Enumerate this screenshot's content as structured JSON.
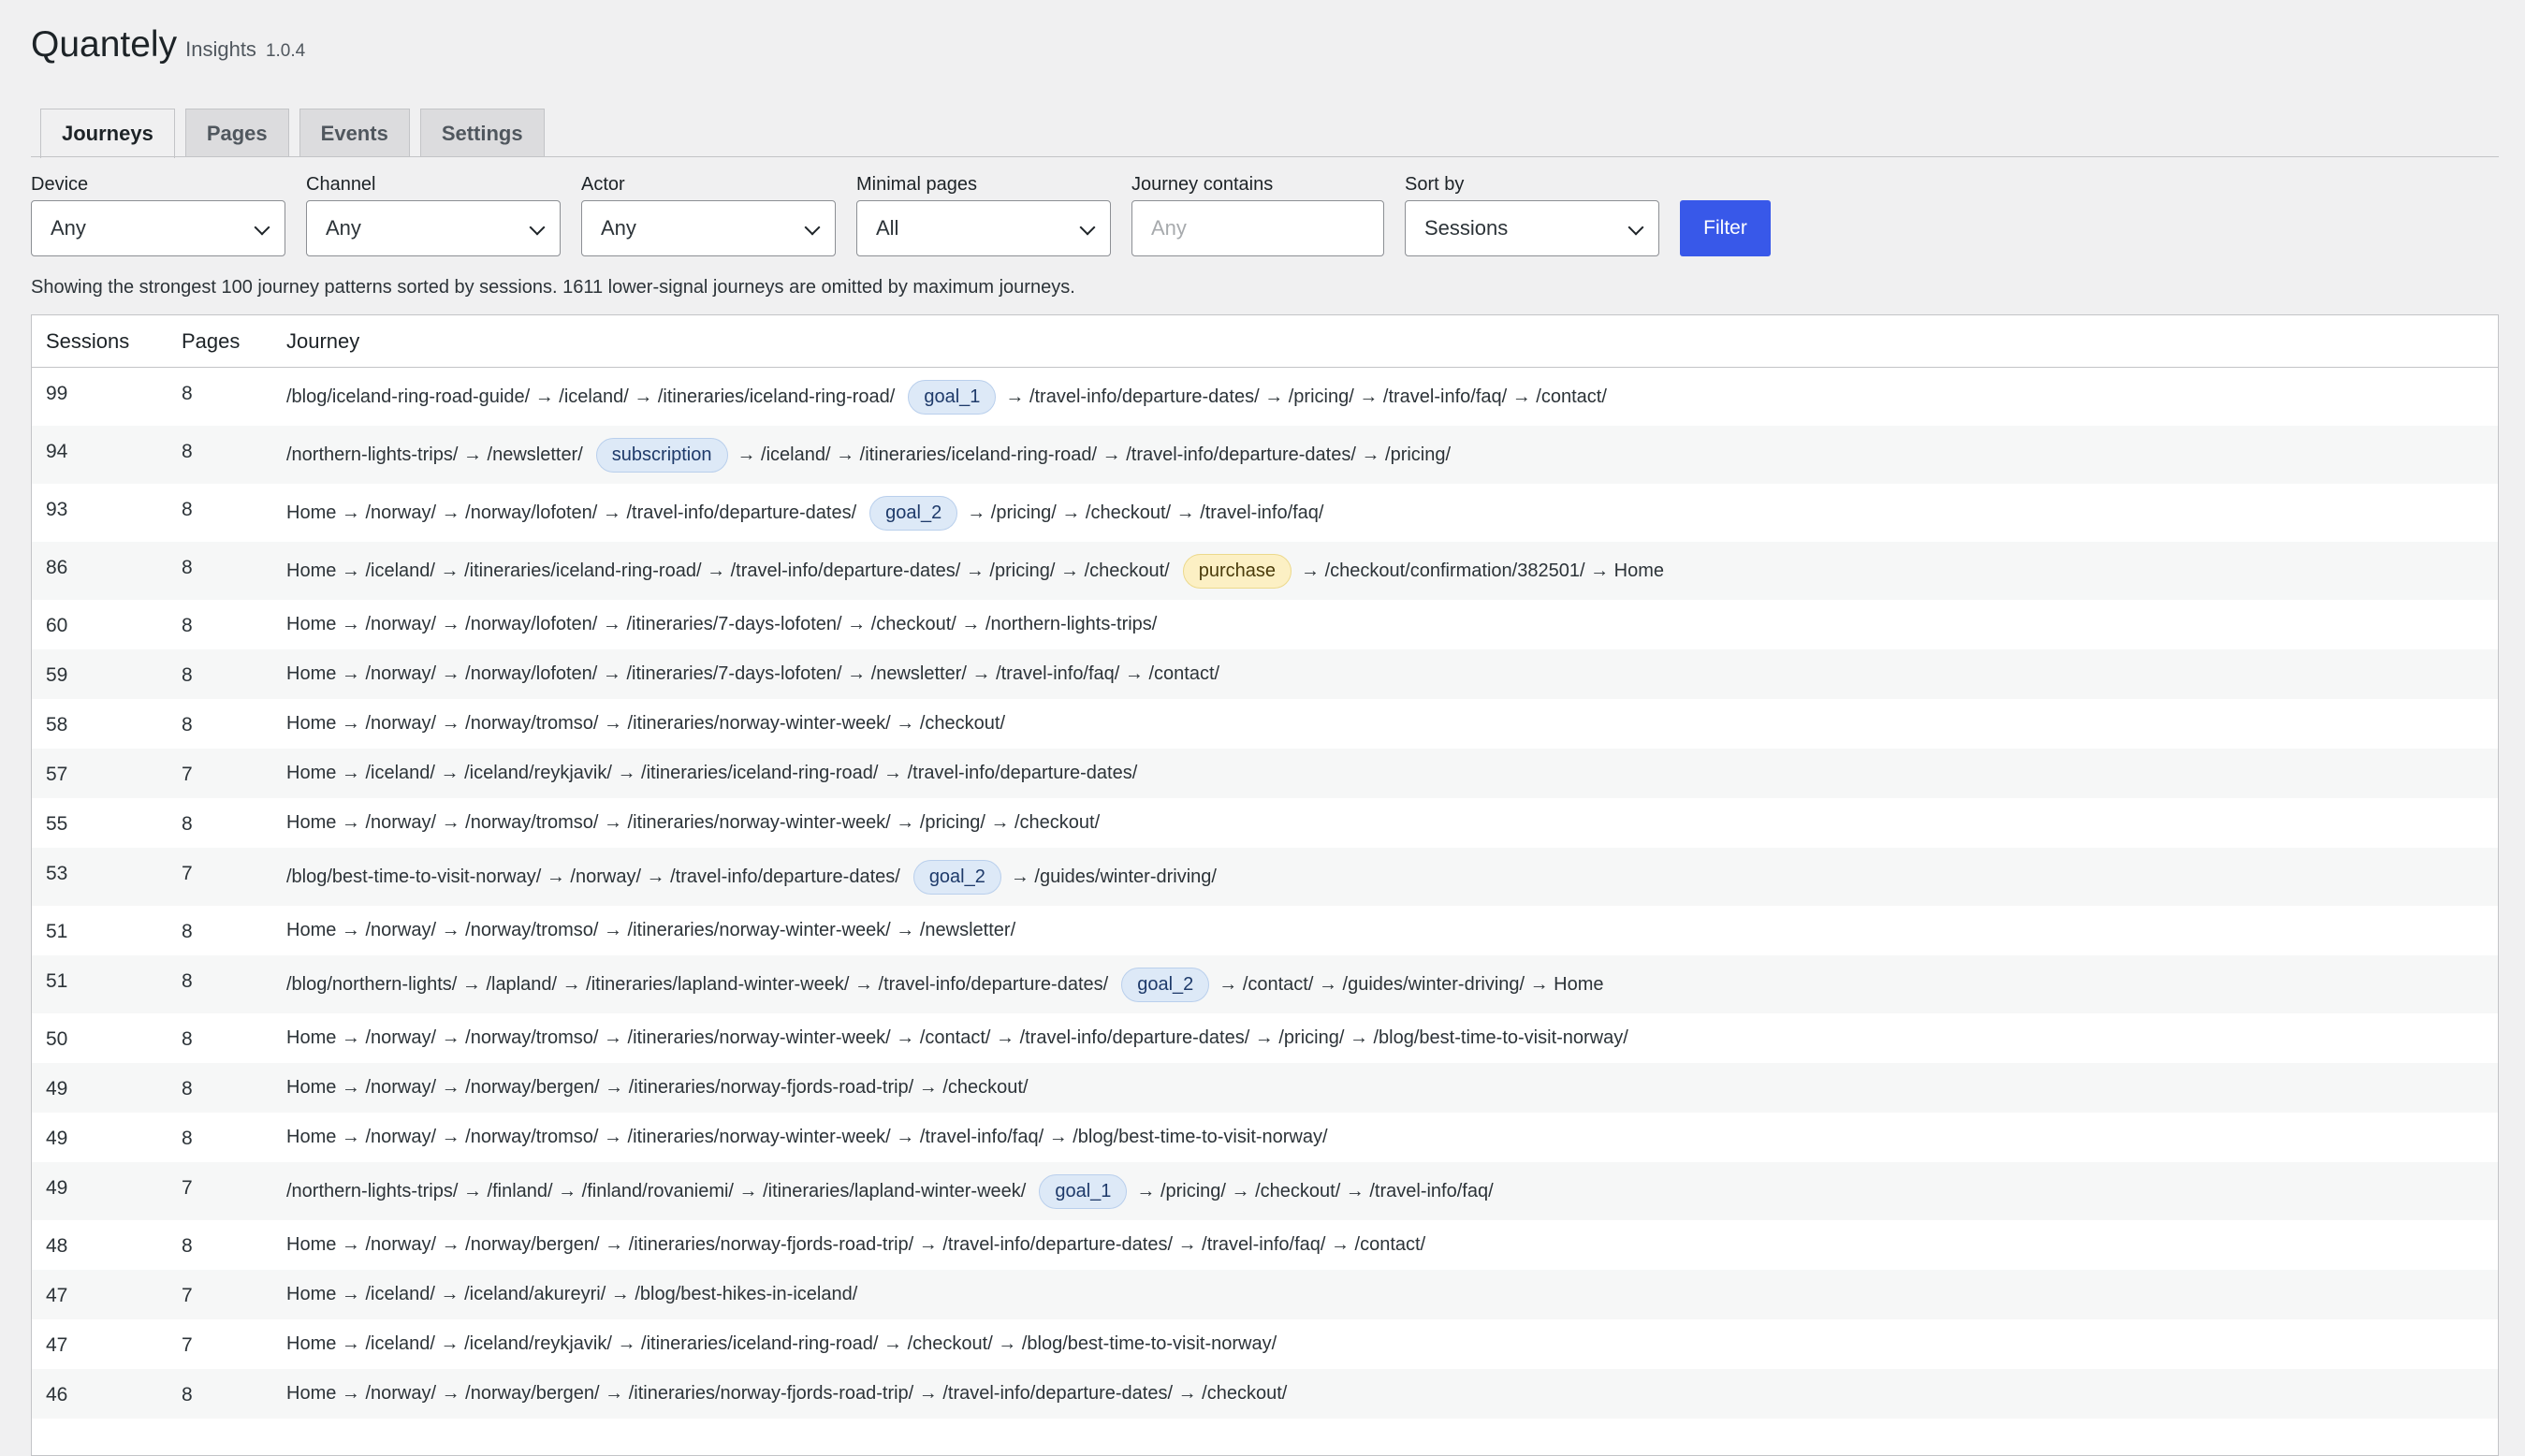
{
  "app": {
    "name": "Quantely",
    "subtitle": "Insights",
    "version": "1.0.4"
  },
  "tabs": [
    {
      "label": "Journeys",
      "active": true
    },
    {
      "label": "Pages",
      "active": false
    },
    {
      "label": "Events",
      "active": false
    },
    {
      "label": "Settings",
      "active": false
    }
  ],
  "filters": {
    "device": {
      "label": "Device",
      "value": "Any"
    },
    "channel": {
      "label": "Channel",
      "value": "Any"
    },
    "actor": {
      "label": "Actor",
      "value": "Any"
    },
    "minimal_pages": {
      "label": "Minimal pages",
      "value": "All"
    },
    "journey_contains": {
      "label": "Journey contains",
      "placeholder": "Any"
    },
    "sort_by": {
      "label": "Sort by",
      "value": "Sessions"
    },
    "filter_button": "Filter"
  },
  "notice": "Showing the strongest 100 journey patterns sorted by sessions. 1611 lower-signal journeys are omitted by maximum journeys.",
  "colors": {
    "accent": "#3858e9",
    "goal_badge": "#dde9f7",
    "purchase_badge": "#fcf0c4"
  },
  "table": {
    "headers": {
      "sessions": "Sessions",
      "pages": "Pages",
      "journey": "Journey"
    },
    "rows": [
      {
        "sessions": "99",
        "pages": "8",
        "pre": "/blog/iceland-ring-road-guide/ → /iceland/ → /itineraries/iceland-ring-road/",
        "badge": "goal_1",
        "badge_type": "goal",
        "post": "→ /travel-info/departure-dates/ → /pricing/ → /travel-info/faq/ → /contact/"
      },
      {
        "sessions": "94",
        "pages": "8",
        "pre": "/northern-lights-trips/ → /newsletter/",
        "badge": "subscription",
        "badge_type": "goal",
        "post": "→ /iceland/ → /itineraries/iceland-ring-road/ → /travel-info/departure-dates/ → /pricing/"
      },
      {
        "sessions": "93",
        "pages": "8",
        "pre": "Home → /norway/ → /norway/lofoten/ → /travel-info/departure-dates/",
        "badge": "goal_2",
        "badge_type": "goal",
        "post": "→ /pricing/ → /checkout/ → /travel-info/faq/"
      },
      {
        "sessions": "86",
        "pages": "8",
        "pre": "Home → /iceland/ → /itineraries/iceland-ring-road/ → /travel-info/departure-dates/ → /pricing/ → /checkout/",
        "badge": "purchase",
        "badge_type": "purchase",
        "post": "→ /checkout/confirmation/382501/ → Home"
      },
      {
        "sessions": "60",
        "pages": "8",
        "pre": "Home → /norway/ → /norway/lofoten/ → /itineraries/7-days-lofoten/ → /checkout/ → /northern-lights-trips/",
        "badge": "",
        "badge_type": "",
        "post": ""
      },
      {
        "sessions": "59",
        "pages": "8",
        "pre": "Home → /norway/ → /norway/lofoten/ → /itineraries/7-days-lofoten/ → /newsletter/ → /travel-info/faq/ → /contact/",
        "badge": "",
        "badge_type": "",
        "post": ""
      },
      {
        "sessions": "58",
        "pages": "8",
        "pre": "Home → /norway/ → /norway/tromso/ → /itineraries/norway-winter-week/ → /checkout/",
        "badge": "",
        "badge_type": "",
        "post": ""
      },
      {
        "sessions": "57",
        "pages": "7",
        "pre": "Home → /iceland/ → /iceland/reykjavik/ → /itineraries/iceland-ring-road/ → /travel-info/departure-dates/",
        "badge": "",
        "badge_type": "",
        "post": ""
      },
      {
        "sessions": "55",
        "pages": "8",
        "pre": "Home → /norway/ → /norway/tromso/ → /itineraries/norway-winter-week/ → /pricing/ → /checkout/",
        "badge": "",
        "badge_type": "",
        "post": ""
      },
      {
        "sessions": "53",
        "pages": "7",
        "pre": "/blog/best-time-to-visit-norway/ → /norway/ → /travel-info/departure-dates/",
        "badge": "goal_2",
        "badge_type": "goal",
        "post": "→ /guides/winter-driving/"
      },
      {
        "sessions": "51",
        "pages": "8",
        "pre": "Home → /norway/ → /norway/tromso/ → /itineraries/norway-winter-week/ → /newsletter/",
        "badge": "",
        "badge_type": "",
        "post": ""
      },
      {
        "sessions": "51",
        "pages": "8",
        "pre": "/blog/northern-lights/ → /lapland/ → /itineraries/lapland-winter-week/ → /travel-info/departure-dates/",
        "badge": "goal_2",
        "badge_type": "goal",
        "post": "→ /contact/ → /guides/winter-driving/ → Home"
      },
      {
        "sessions": "50",
        "pages": "8",
        "pre": "Home → /norway/ → /norway/tromso/ → /itineraries/norway-winter-week/ → /contact/ → /travel-info/departure-dates/ → /pricing/ → /blog/best-time-to-visit-norway/",
        "badge": "",
        "badge_type": "",
        "post": ""
      },
      {
        "sessions": "49",
        "pages": "8",
        "pre": "Home → /norway/ → /norway/bergen/ → /itineraries/norway-fjords-road-trip/ → /checkout/",
        "badge": "",
        "badge_type": "",
        "post": ""
      },
      {
        "sessions": "49",
        "pages": "8",
        "pre": "Home → /norway/ → /norway/tromso/ → /itineraries/norway-winter-week/ → /travel-info/faq/ → /blog/best-time-to-visit-norway/",
        "badge": "",
        "badge_type": "",
        "post": ""
      },
      {
        "sessions": "49",
        "pages": "7",
        "pre": "/northern-lights-trips/ → /finland/ → /finland/rovaniemi/ → /itineraries/lapland-winter-week/",
        "badge": "goal_1",
        "badge_type": "goal",
        "post": "→ /pricing/ → /checkout/ → /travel-info/faq/"
      },
      {
        "sessions": "48",
        "pages": "8",
        "pre": "Home → /norway/ → /norway/bergen/ → /itineraries/norway-fjords-road-trip/ → /travel-info/departure-dates/ → /travel-info/faq/ → /contact/",
        "badge": "",
        "badge_type": "",
        "post": ""
      },
      {
        "sessions": "47",
        "pages": "7",
        "pre": "Home → /iceland/ → /iceland/akureyri/ → /blog/best-hikes-in-iceland/",
        "badge": "",
        "badge_type": "",
        "post": ""
      },
      {
        "sessions": "47",
        "pages": "7",
        "pre": "Home → /iceland/ → /iceland/reykjavik/ → /itineraries/iceland-ring-road/ → /checkout/ → /blog/best-time-to-visit-norway/",
        "badge": "",
        "badge_type": "",
        "post": ""
      },
      {
        "sessions": "46",
        "pages": "8",
        "pre": "Home → /norway/ → /norway/bergen/ → /itineraries/norway-fjords-road-trip/ → /travel-info/departure-dates/ → /checkout/",
        "badge": "",
        "badge_type": "",
        "post": ""
      }
    ]
  }
}
